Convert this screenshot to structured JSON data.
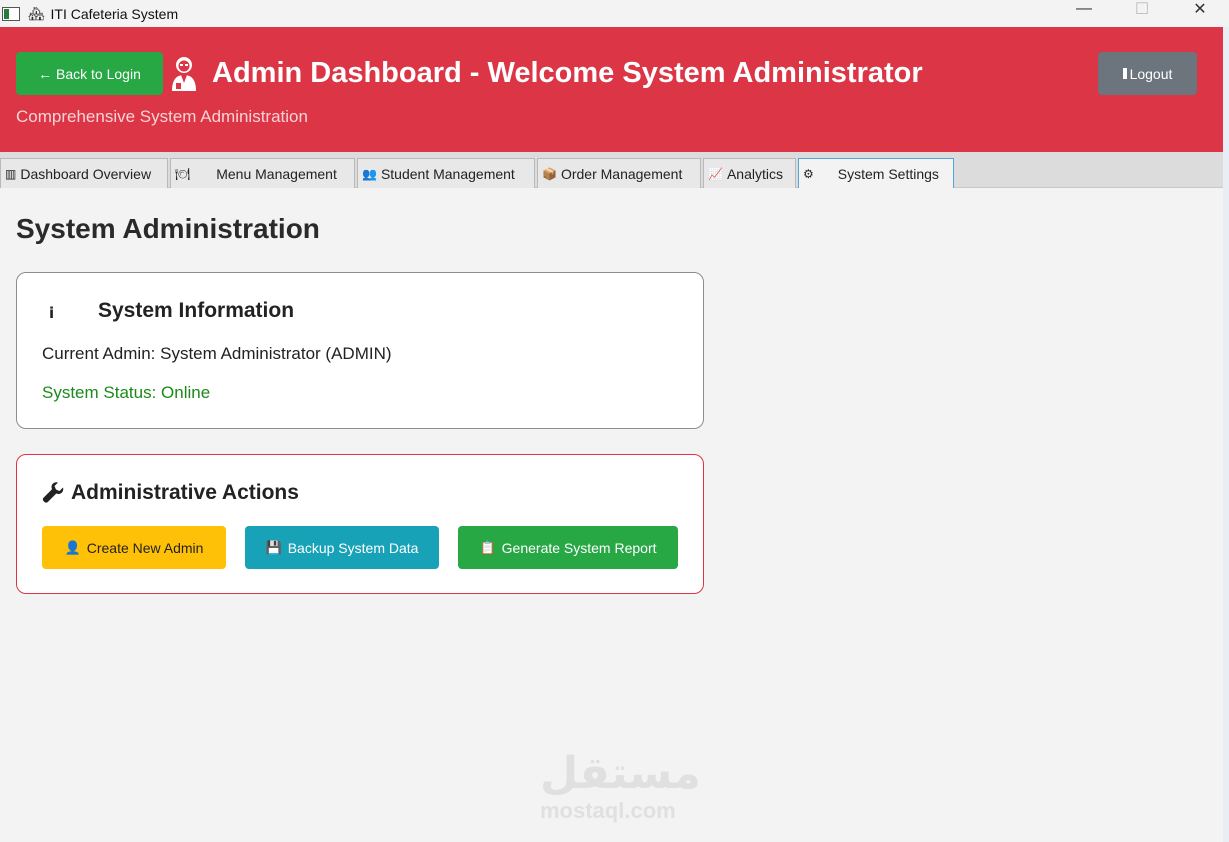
{
  "window": {
    "title": "ITI Cafeteria System",
    "controls": {
      "minimize": "—",
      "maximize": "☐",
      "close": "✕"
    }
  },
  "header": {
    "back_button": "← Back to Login",
    "title": "Admin Dashboard - Welcome System Administrator",
    "subtitle": "Comprehensive System Administration",
    "logout_button": "Logout",
    "icon": "admin-avatar-icon",
    "color": "#dc3545"
  },
  "tabs": [
    {
      "label": "Dashboard Overview",
      "icon": "bar-chart-icon",
      "active": false
    },
    {
      "label": "Menu Management",
      "icon": "plate-icon",
      "active": false
    },
    {
      "label": "Student Management",
      "icon": "users-icon",
      "active": false
    },
    {
      "label": "Order Management",
      "icon": "package-icon",
      "active": false
    },
    {
      "label": "Analytics",
      "icon": "line-chart-icon",
      "active": false
    },
    {
      "label": "System Settings",
      "icon": "gear-icon",
      "active": true
    }
  ],
  "main": {
    "page_title": "System Administration",
    "system_info": {
      "icon_glyph": "i",
      "title": "System Information",
      "current_admin": "Current Admin: System Administrator (ADMIN)",
      "status": "System Status: Online",
      "status_color": "#1a8a1a"
    },
    "admin_actions": {
      "title": "Administrative Actions",
      "buttons": [
        {
          "label": "Create New Admin",
          "icon": "person-icon",
          "color": "#ffc107"
        },
        {
          "label": "Backup System Data",
          "icon": "floppy-disk-icon",
          "color": "#17a2b8"
        },
        {
          "label": "Generate System Report",
          "icon": "clipboard-icon",
          "color": "#28a745"
        }
      ]
    }
  },
  "watermark": {
    "arabic": "مستقل",
    "latin": "mostaql.com"
  }
}
